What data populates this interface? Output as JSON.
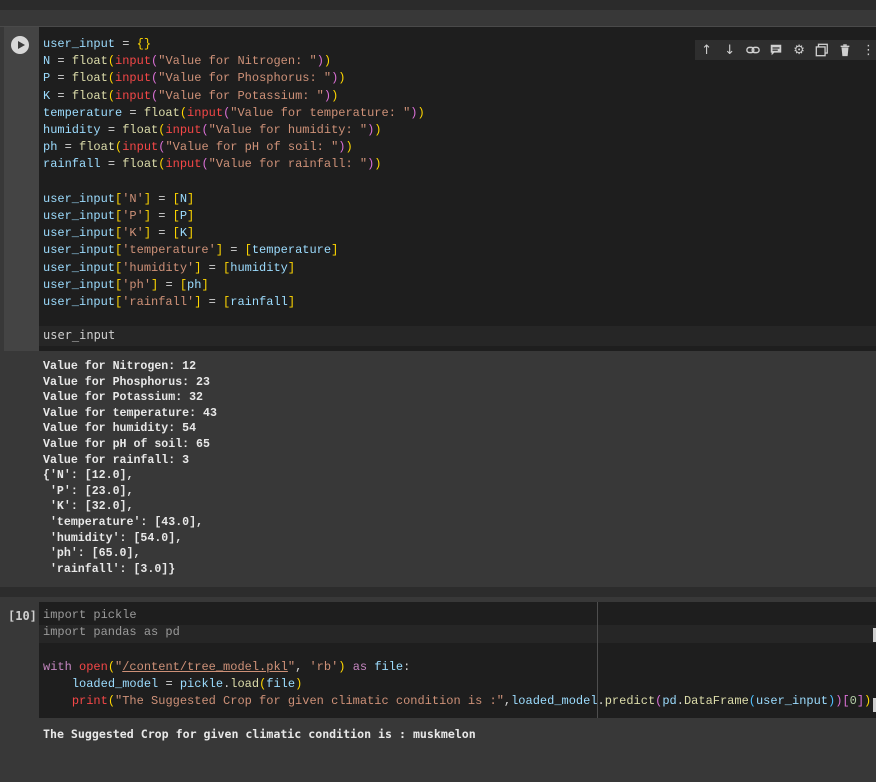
{
  "cell1": {
    "code_lines": [
      "user_input = {}",
      "N = float(input(\"Value for Nitrogen: \"))",
      "P = float(input(\"Value for Phosphorus: \"))",
      "K = float(input(\"Value for Potassium: \"))",
      "temperature = float(input(\"Value for temperature: \"))",
      "humidity = float(input(\"Value for humidity: \"))",
      "ph = float(input(\"Value for pH of soil: \"))",
      "rainfall = float(input(\"Value for rainfall: \"))",
      "",
      "user_input['N'] = [N]",
      "user_input['P'] = [P]",
      "user_input['K'] = [K]",
      "user_input['temperature'] = [temperature]",
      "user_input['humidity'] = [humidity]",
      "user_input['ph'] = [ph]",
      "user_input['rainfall'] = [rainfall]"
    ],
    "last_line": "user_input",
    "output_lines": [
      "Value for Nitrogen: 12",
      "Value for Phosphorus: 23",
      "Value for Potassium: 32",
      "Value for temperature: 43",
      "Value for humidity: 54",
      "Value for pH of soil: 65",
      "Value for rainfall: 3",
      "{'N': [12.0],",
      " 'P': [23.0],",
      " 'K': [32.0],",
      " 'temperature': [43.0],",
      " 'humidity': [54.0],",
      " 'ph': [65.0],",
      " 'rainfall': [3.0]}"
    ]
  },
  "toolbar": {
    "icons": [
      "arrow-up-icon",
      "arrow-down-icon",
      "link-icon",
      "comment-icon",
      "gear-icon",
      "mirror-cell-icon",
      "trash-icon",
      "more-vert-icon"
    ],
    "glyphs": [
      "↑",
      "↓",
      "⚭",
      "▤",
      "⚙",
      "⧉",
      "🗑",
      "⋮"
    ]
  },
  "cell2": {
    "exec_count": "[10]",
    "code_lines": [
      "import pickle",
      "import pandas as pd",
      "",
      "with open(\"/content/tree_model.pkl\", 'rb') as file:",
      "    loaded_model = pickle.load(file)",
      "    print(\"The Suggested Crop for given climatic condition is :\",loaded_model.predict(pd.DataFrame(user_input))[0])"
    ],
    "output": "The Suggested Crop for given climatic condition is : muskmelon"
  },
  "colors": {
    "editor_bg": "#1e1e1e",
    "output_bg": "#383838",
    "string": "#ce9178",
    "keyword": "#c586c0"
  }
}
